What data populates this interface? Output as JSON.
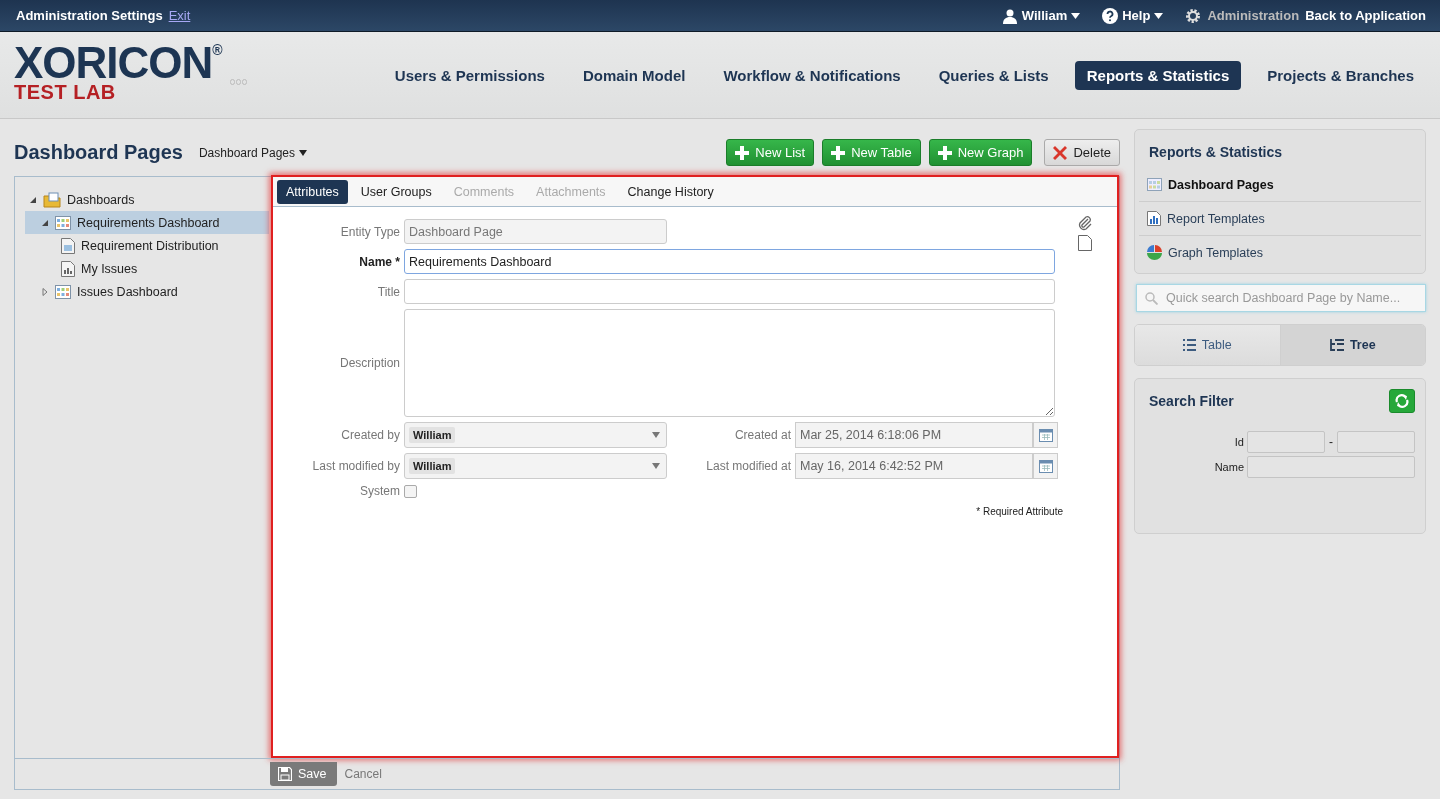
{
  "topbar": {
    "title": "Administration Settings",
    "exit_link": "Exit",
    "user_menu": "William",
    "help_menu": "Help",
    "admin_label": "Administration",
    "back_link": "Back to Application"
  },
  "logo": {
    "name": "XORICON$^{®}$",
    "subtitle": "TEST LAB"
  },
  "nav": [
    {
      "label": "Users & Permissions",
      "selected": false
    },
    {
      "label": "Domain Model",
      "selected": false
    },
    {
      "label": "Workflow & Notifications",
      "selected": false
    },
    {
      "label": "Queries & Lists",
      "selected": false
    },
    {
      "label": "Reports & Statistics",
      "selected": true
    },
    {
      "label": "Projects & Branches",
      "selected": false
    }
  ],
  "page": {
    "title": "Dashboard Pages",
    "dropdown": "Dashboard Pages"
  },
  "toolbar": [
    {
      "label": "New List",
      "kind": "add"
    },
    {
      "label": "New Table",
      "kind": "add"
    },
    {
      "label": "New Graph",
      "kind": "add"
    },
    {
      "label": "Delete",
      "kind": "delete"
    }
  ],
  "tree": [
    {
      "label": "Dashboards",
      "kind": "folder",
      "selected": false,
      "expanded": true,
      "children": [
        {
          "label": "Requirements Dashboard",
          "kind": "dashboard",
          "selected": true,
          "expanded": true,
          "children": [
            {
              "label": "Requirement Distribution",
              "kind": "chart-doc",
              "selected": false
            },
            {
              "label": "My Issues",
              "kind": "list-doc",
              "selected": false
            }
          ]
        },
        {
          "label": "Issues Dashboard",
          "kind": "dashboard",
          "selected": false,
          "expanded": false
        }
      ]
    }
  ],
  "tabs": [
    {
      "label": "Attributes",
      "selected": true,
      "disabled": false
    },
    {
      "label": "User Groups",
      "selected": false,
      "disabled": false
    },
    {
      "label": "Comments",
      "selected": false,
      "disabled": true
    },
    {
      "label": "Attachments",
      "selected": false,
      "disabled": true
    },
    {
      "label": "Change History",
      "selected": false,
      "disabled": false
    }
  ],
  "form": {
    "fields": [
      {
        "kind": "text",
        "label": "Entity Type",
        "value": "Dashboard Page",
        "disabled": true,
        "required": false,
        "focused": false
      },
      {
        "kind": "text",
        "label": "Name *",
        "value": "Requirements Dashboard",
        "disabled": false,
        "required": true,
        "focused": true
      },
      {
        "kind": "text",
        "label": "Title",
        "disabled": false,
        "required": false,
        "focused": false
      },
      {
        "kind": "textarea",
        "label": "Description",
        "disabled": false,
        "required": false,
        "focused": false
      }
    ],
    "meta": [
      {
        "left_label": "Created by",
        "left_value": "William",
        "right_label": "Created at",
        "right_value": "Mar 25, 2014 6:18:06 PM"
      },
      {
        "left_label": "Last modified by",
        "left_value": "William",
        "right_label": "Last modified at",
        "right_value": "May 16, 2014 6:42:52 PM"
      }
    ],
    "system": {
      "label": "System",
      "checked": false
    },
    "required_note": "* Required Attribute"
  },
  "footer": {
    "save": "Save",
    "cancel": "Cancel"
  },
  "sidebar": {
    "title": "Reports & Statistics",
    "items": [
      {
        "label": "Dashboard Pages",
        "kind": "dashboard",
        "selected": true
      },
      {
        "label": "Report Templates",
        "kind": "report",
        "selected": false
      },
      {
        "label": "Graph Templates",
        "kind": "graph",
        "selected": false
      }
    ],
    "search_placeholder": "Quick search Dashboard Page by Name...",
    "views": [
      {
        "label": "Table",
        "kind": "table",
        "selected": false
      },
      {
        "label": "Tree",
        "kind": "tree",
        "selected": true
      }
    ],
    "filter": {
      "title": "Search Filter",
      "id_label": "Id",
      "range_sep": "-",
      "name_label": "Name"
    }
  }
}
